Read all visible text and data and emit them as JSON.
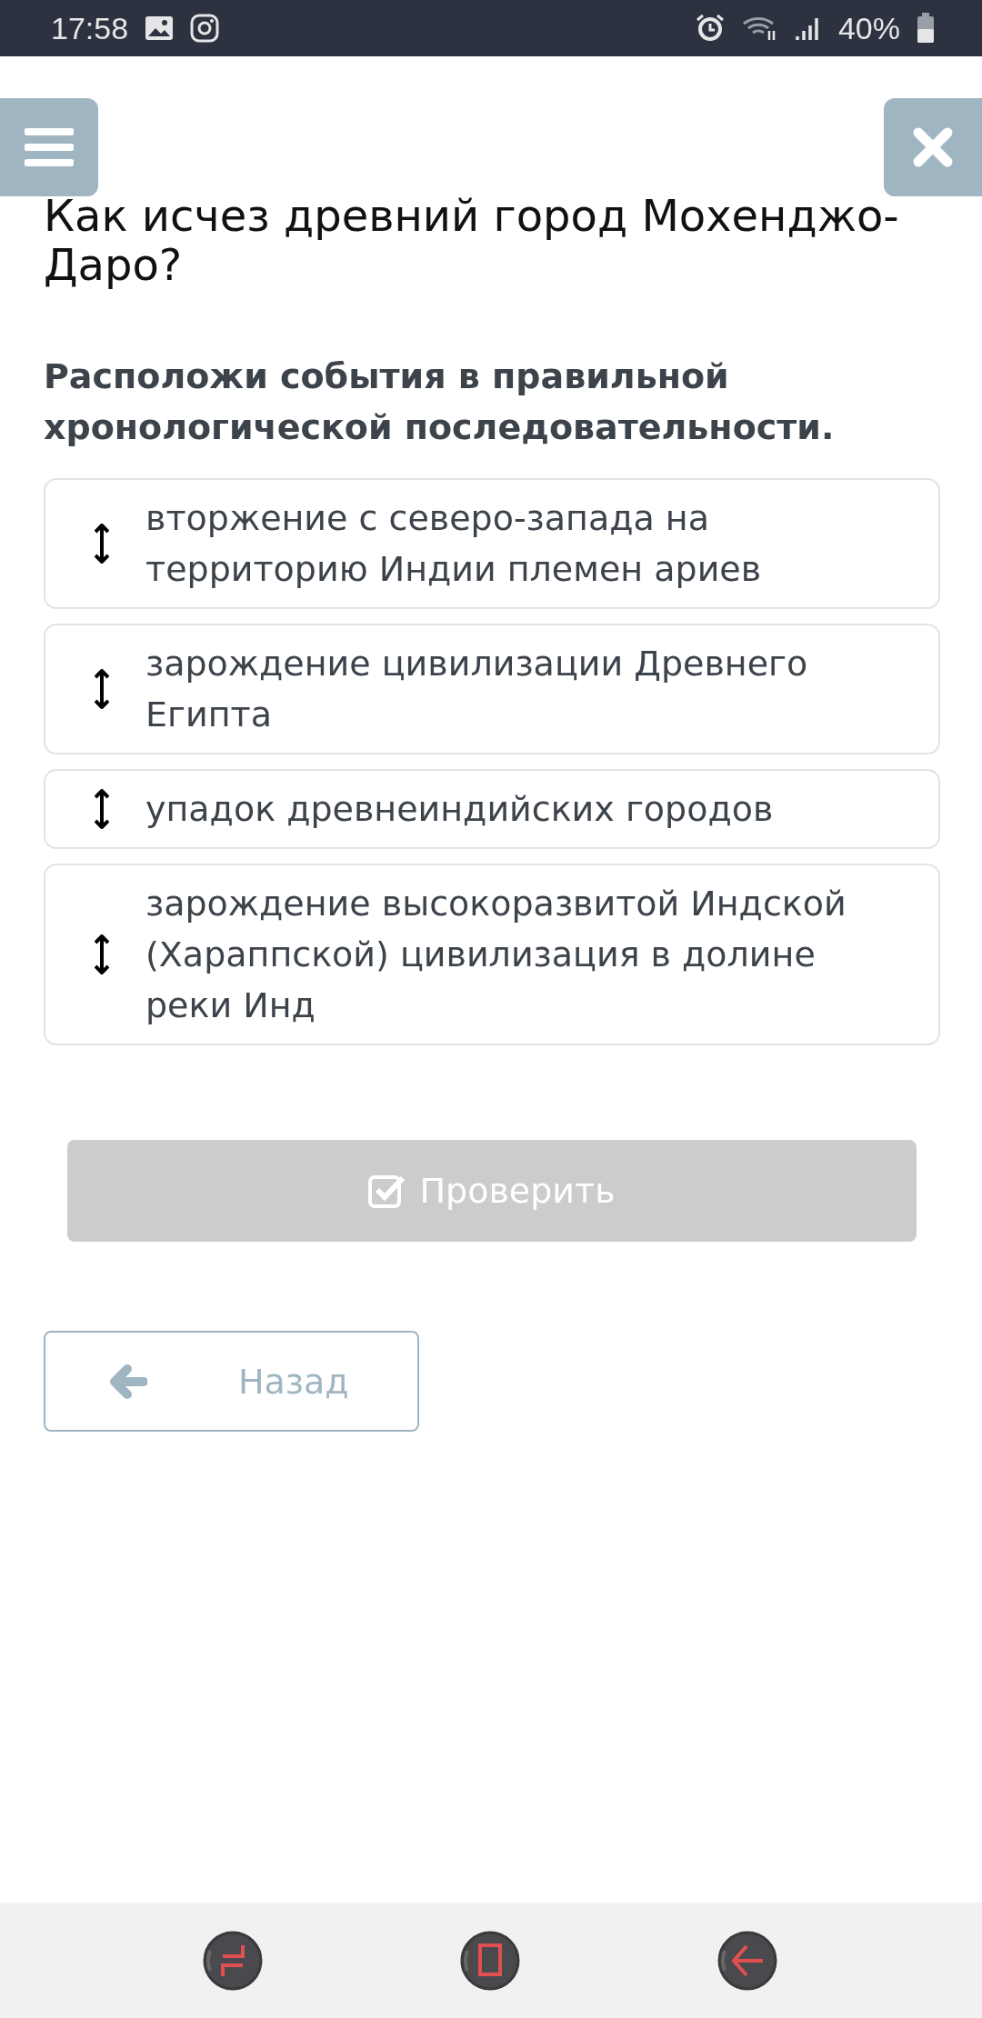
{
  "status_bar": {
    "time": "17:58",
    "battery": "40%"
  },
  "question": {
    "title": "Как исчез древний город Мохенджо-Даро?",
    "instruction": "Расположи события в правильной хронологической последовательности."
  },
  "items": [
    {
      "text": "вторжение с северо-запада на территорию Индии племен ариев"
    },
    {
      "text": "зарождение цивилизации Древнего Египта"
    },
    {
      "text": "упадок древнеиндийских городов"
    },
    {
      "text": "зарождение высокоразвитой Индской (Хараппской) цивилизация в долине реки Инд"
    }
  ],
  "check_button": {
    "label": "Проверить",
    "disabled": true
  },
  "back_button": {
    "label": "Назад"
  }
}
